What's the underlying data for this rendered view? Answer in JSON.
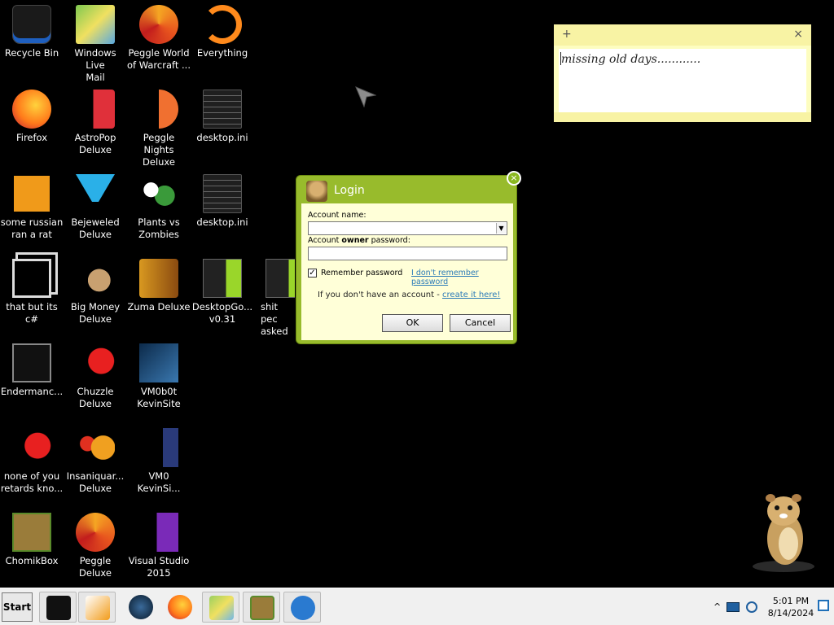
{
  "desktop": {
    "icons": [
      {
        "label": "Recycle Bin",
        "icon": "recycle-bin-icon"
      },
      {
        "label": "Windows Live\nMail",
        "icon": "mail-icon"
      },
      {
        "label": "Peggle World\nof Warcraft ...",
        "icon": "peggle-icon"
      },
      {
        "label": "Everything",
        "icon": "everything-icon"
      },
      {
        "label": "Firefox",
        "icon": "firefox-icon"
      },
      {
        "label": "AstroPop\nDeluxe",
        "icon": "astropop-icon"
      },
      {
        "label": "Peggle Nights\nDeluxe",
        "icon": "peggle-nights-icon"
      },
      {
        "label": "desktop.ini",
        "icon": "ini-file-icon"
      },
      {
        "label": "some russian\nran a rat",
        "icon": "app-icon"
      },
      {
        "label": "Bejeweled\nDeluxe",
        "icon": "bejeweled-icon"
      },
      {
        "label": "Plants vs\nZombies",
        "icon": "plants-icon"
      },
      {
        "label": "desktop.ini",
        "icon": "ini-file-icon"
      },
      {
        "label": "that but its c#",
        "icon": "windows-icon"
      },
      {
        "label": "Big Money\nDeluxe",
        "icon": "big-money-icon"
      },
      {
        "label": "Zuma Deluxe",
        "icon": "zuma-icon"
      },
      {
        "label": "DesktopGo...\nv0.31",
        "icon": "folder-icon"
      },
      {
        "label": "shit pec\nasked m",
        "icon": "folder-icon"
      },
      {
        "label": "Endermanc...",
        "icon": "terminal-icon"
      },
      {
        "label": "Chuzzle\nDeluxe",
        "icon": "chuzzle-icon"
      },
      {
        "label": "VM0b0t\nKevinSite",
        "icon": "vm-icon"
      },
      {
        "label": "none of you\nretards kno...",
        "icon": "app-icon"
      },
      {
        "label": "Insaniquar...\nDeluxe",
        "icon": "insaniquarium-icon"
      },
      {
        "label": "VM0\nKevinSi...",
        "icon": "vm-file-icon"
      },
      {
        "label": "ChomikBox",
        "icon": "chomikbox-icon"
      },
      {
        "label": "Peggle Deluxe",
        "icon": "peggle-icon"
      },
      {
        "label": "Visual Studio\n2015",
        "icon": "visual-studio-icon"
      }
    ]
  },
  "sticky_note": {
    "plus": "+",
    "close": "×",
    "text": "missing old days............"
  },
  "login": {
    "title": "Login",
    "close": "×",
    "account_name_label": "Account name:",
    "account_name_value": "",
    "owner_label_pre": "Account ",
    "owner_label_bold": "owner",
    "owner_label_post": " password:",
    "password_value": "",
    "remember_label": "Remember password",
    "remember_checked": true,
    "forgot_link": "I don't remember password",
    "no_account_text": "If you don't have an account - ",
    "create_link": "create it here!",
    "ok_label": "OK",
    "cancel_label": "Cancel",
    "accent": "#98bb2c"
  },
  "taskbar": {
    "start_label": "Start",
    "apps": [
      {
        "name": "windows-icon"
      },
      {
        "name": "media-player-icon"
      },
      {
        "name": "app-orb-icon"
      },
      {
        "name": "firefox-icon"
      },
      {
        "name": "explorer-icon"
      },
      {
        "name": "chomikbox-icon"
      },
      {
        "name": "eject-icon"
      }
    ],
    "tray": {
      "chevron": "^",
      "time": "5:01 PM",
      "date": "8/14/2024"
    }
  }
}
